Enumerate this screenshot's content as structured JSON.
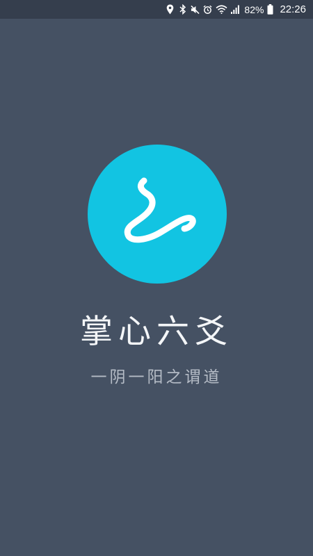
{
  "status_bar": {
    "icons": [
      "location-icon",
      "bluetooth-icon",
      "mute-icon",
      "alarm-icon",
      "wifi-icon",
      "signal-icon",
      "battery-icon"
    ],
    "battery_percent": "82%",
    "time": "22:26"
  },
  "splash": {
    "logo_icon": "snake-script-logo-icon",
    "logo_color": "#12c4e2",
    "title": "掌心六爻",
    "subtitle": "一阴一阳之谓道"
  },
  "colors": {
    "background": "#455163",
    "status_bar": "#353e4d",
    "title_text": "#f4f6f8",
    "subtitle_text": "#b5bcc6"
  }
}
